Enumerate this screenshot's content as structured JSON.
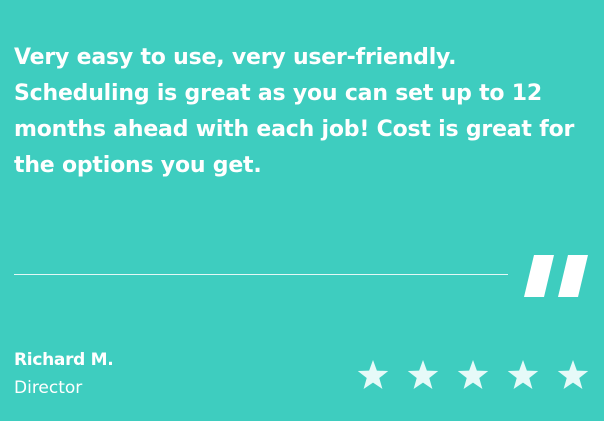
{
  "colors": {
    "background": "#3ecdbf",
    "text": "#ffffff",
    "star": "#e6faf8"
  },
  "testimonial": {
    "quote": "Very easy to use, very user-friendly. Scheduling is great as you can set up to 12 months ahead with each job! Cost is great for the options you get.",
    "author_name": "Richard M.",
    "author_role": "Director",
    "rating": 5,
    "rating_max": 5,
    "icons": {
      "quote": "quote-mark-icon",
      "star": "star-icon"
    }
  }
}
